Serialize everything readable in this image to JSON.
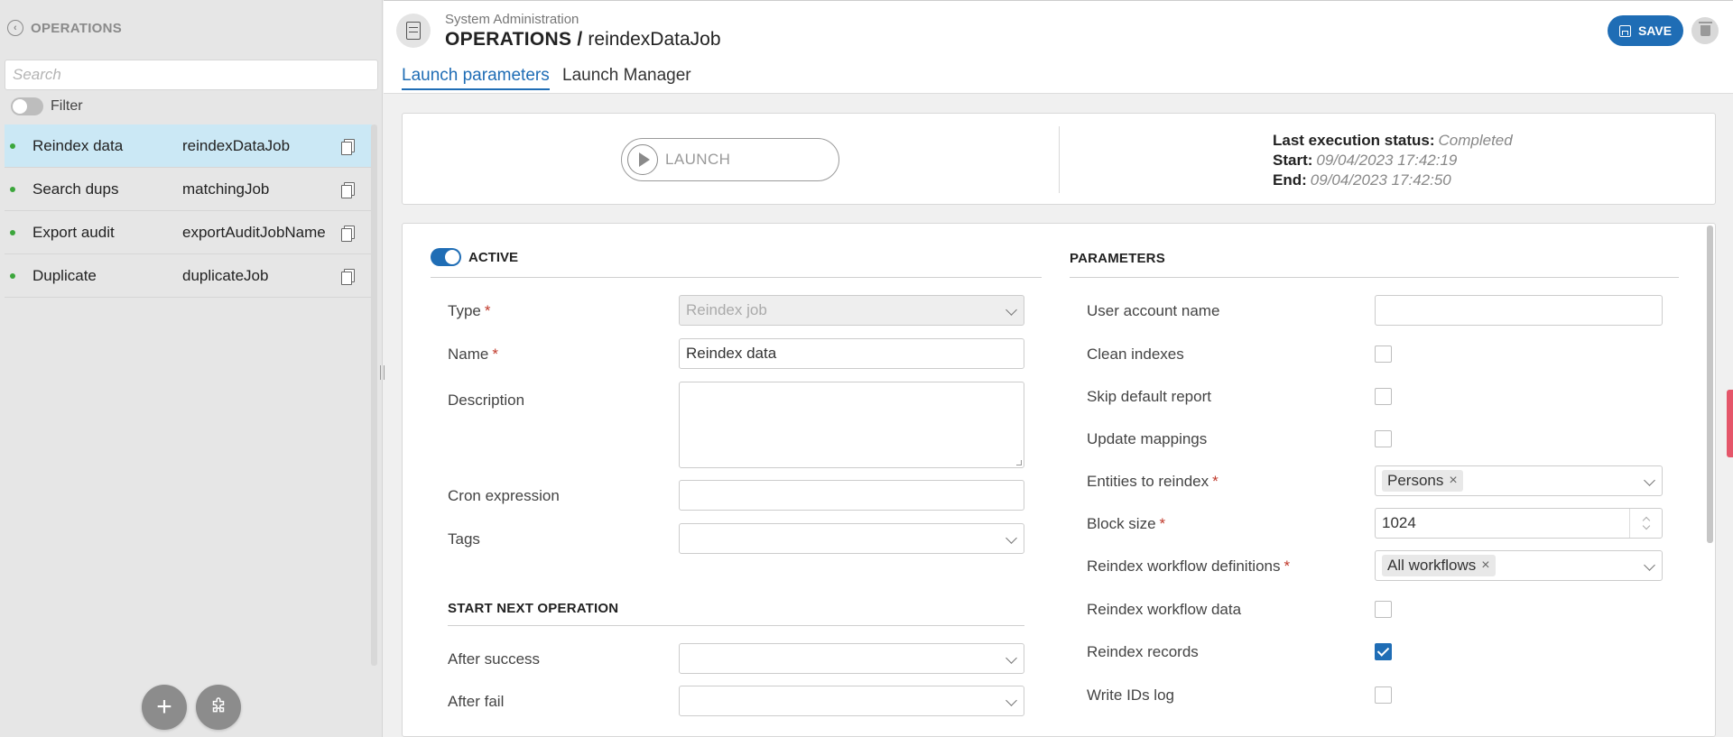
{
  "sidebar": {
    "title": "OPERATIONS",
    "search_placeholder": "Search",
    "filter_label": "Filter",
    "items": [
      {
        "name": "Reindex data",
        "code": "reindexDataJob"
      },
      {
        "name": "Search dups",
        "code": "matchingJob"
      },
      {
        "name": "Export audit",
        "code": "exportAuditJobName"
      },
      {
        "name": "Duplicate",
        "code": "duplicateJob"
      }
    ],
    "add_label": "+"
  },
  "header": {
    "subtitle": "System Administration",
    "title_section": "OPERATIONS /",
    "title_name": "reindexDataJob",
    "save_label": "SAVE",
    "tabs": [
      {
        "label": "Launch parameters"
      },
      {
        "label": "Launch Manager"
      }
    ]
  },
  "launch": {
    "button_label": "LAUNCH",
    "status_label": "Last execution status:",
    "status_value": "Completed",
    "start_label": "Start:",
    "start_value": "09/04/2023 17:42:19",
    "end_label": "End:",
    "end_value": "09/04/2023 17:42:50"
  },
  "form": {
    "active_label": "ACTIVE",
    "type_label": "Type",
    "type_value": "Reindex job",
    "name_label": "Name",
    "name_value": "Reindex data",
    "description_label": "Description",
    "cron_label": "Cron expression",
    "tags_label": "Tags",
    "next_section": "START NEXT OPERATION",
    "after_success_label": "After success",
    "after_fail_label": "After fail",
    "required_mark": "*"
  },
  "params": {
    "section": "PARAMETERS",
    "user_account_label": "User account name",
    "clean_indexes_label": "Clean indexes",
    "skip_report_label": "Skip default report",
    "update_mappings_label": "Update mappings",
    "entities_label": "Entities to reindex",
    "entities_tag": "Persons",
    "block_size_label": "Block size",
    "block_size_value": "1024",
    "workflow_defs_label": "Reindex workflow definitions",
    "workflow_defs_tag": "All workflows",
    "workflow_data_label": "Reindex workflow data",
    "records_label": "Reindex records",
    "write_ids_label": "Write IDs log"
  }
}
